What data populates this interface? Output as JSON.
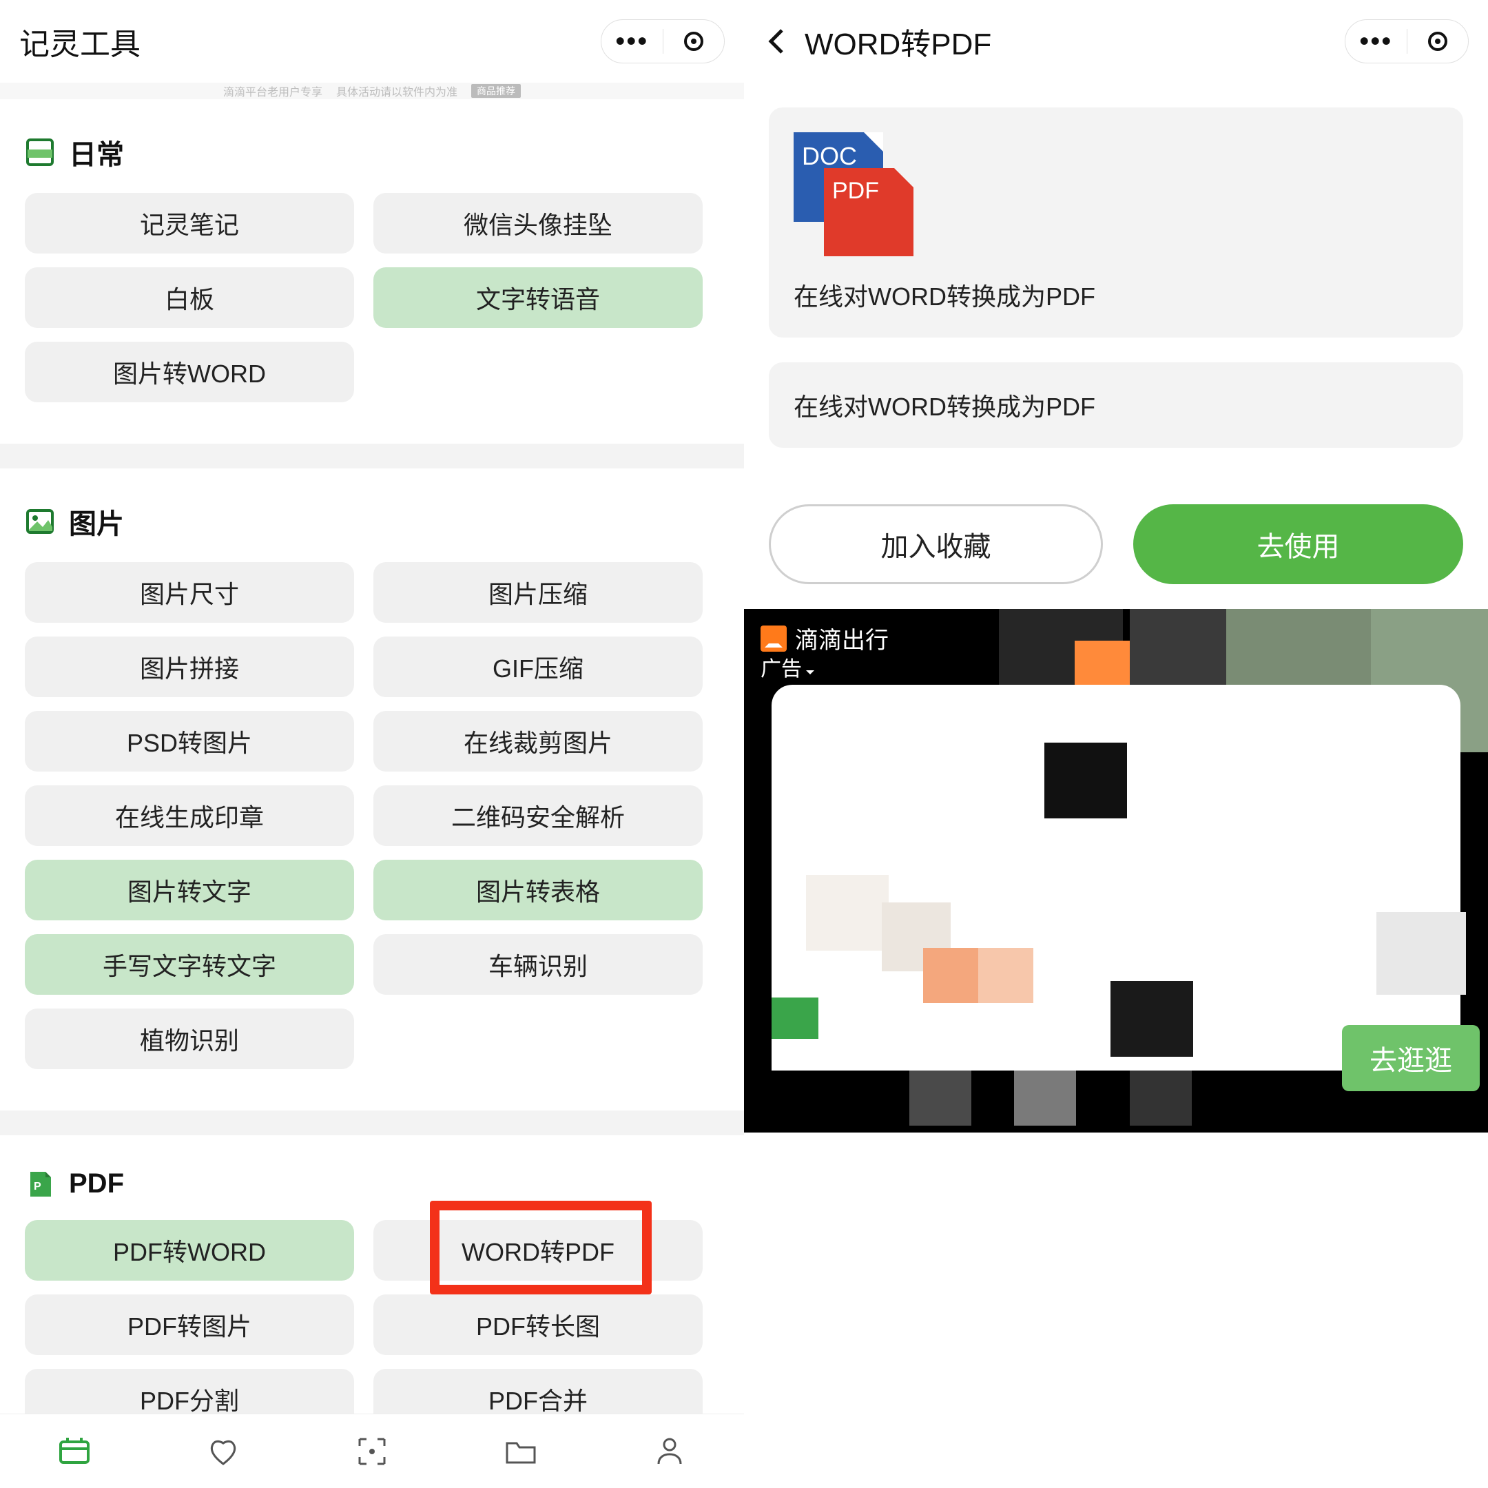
{
  "left": {
    "app_title": "记灵工具",
    "ad_strip_text_left": "滴滴平台老用户专享",
    "ad_strip_text_right": "具体活动请以软件内为准",
    "ad_strip_tag": "商品推荐",
    "sections": [
      {
        "title": "日常",
        "items": [
          {
            "label": "记灵笔记",
            "hi": false
          },
          {
            "label": "微信头像挂坠",
            "hi": false
          },
          {
            "label": "白板",
            "hi": false
          },
          {
            "label": "文字转语音",
            "hi": true
          },
          {
            "label": "图片转WORD",
            "hi": false
          }
        ]
      },
      {
        "title": "图片",
        "items": [
          {
            "label": "图片尺寸",
            "hi": false
          },
          {
            "label": "图片压缩",
            "hi": false
          },
          {
            "label": "图片拼接",
            "hi": false
          },
          {
            "label": "GIF压缩",
            "hi": false
          },
          {
            "label": "PSD转图片",
            "hi": false
          },
          {
            "label": "在线裁剪图片",
            "hi": false
          },
          {
            "label": "在线生成印章",
            "hi": false
          },
          {
            "label": "二维码安全解析",
            "hi": false
          },
          {
            "label": "图片转文字",
            "hi": true
          },
          {
            "label": "图片转表格",
            "hi": true
          },
          {
            "label": "手写文字转文字",
            "hi": true
          },
          {
            "label": "车辆识别",
            "hi": false
          },
          {
            "label": "植物识别",
            "hi": false
          }
        ]
      },
      {
        "title": "PDF",
        "items": [
          {
            "label": "PDF转WORD",
            "hi": true
          },
          {
            "label": "WORD转PDF",
            "hi": false,
            "red_frame": true
          },
          {
            "label": "PDF转图片",
            "hi": false
          },
          {
            "label": "PDF转长图",
            "hi": false
          },
          {
            "label": "PDF分割",
            "hi": false
          },
          {
            "label": "PDF合并",
            "hi": false
          }
        ]
      }
    ],
    "tabs": [
      "工具",
      "收藏",
      "拍照",
      "文件",
      "我的"
    ]
  },
  "right": {
    "title": "WORD转PDF",
    "doc_label": "DOC",
    "pdf_label": "PDF",
    "desc1": "在线对WORD转换成为PDF",
    "desc2": "在线对WORD转换成为PDF",
    "btn_fav": "加入收藏",
    "btn_use": "去使用",
    "ad_brand": "滴滴出行",
    "ad_tag": "广告",
    "ad_go": "去逛逛"
  }
}
